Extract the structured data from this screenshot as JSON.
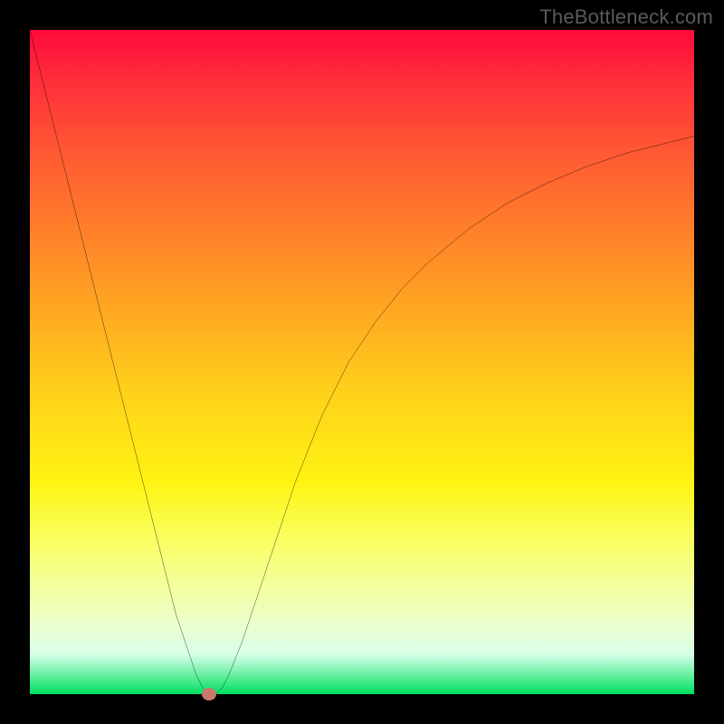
{
  "watermark": "TheBottleneck.com",
  "chart_data": {
    "type": "line",
    "title": "",
    "xlabel": "",
    "ylabel": "",
    "xlim": [
      0,
      100
    ],
    "ylim": [
      0,
      100
    ],
    "series": [
      {
        "name": "bottleneck-curve",
        "x": [
          0,
          2,
          4,
          6,
          8,
          10,
          12,
          14,
          16,
          18,
          20,
          22,
          24,
          25,
          26,
          27,
          28,
          29,
          30,
          32,
          34,
          36,
          38,
          40,
          44,
          48,
          52,
          56,
          60,
          66,
          72,
          78,
          84,
          90,
          96,
          100
        ],
        "y": [
          100,
          92,
          84,
          76,
          68,
          60,
          52,
          44,
          36,
          28,
          20,
          12,
          6,
          3,
          1,
          0,
          0,
          1,
          3,
          8,
          14,
          20,
          26,
          32,
          42,
          50,
          56,
          61,
          65,
          70,
          74,
          77,
          79.5,
          81.5,
          83,
          84
        ]
      }
    ],
    "marker": {
      "x": 27,
      "y": 0,
      "color": "#c77a6a"
    },
    "gradient_colors": {
      "top": "#ff0a3c",
      "mid_upper": "#ff7f2a",
      "mid": "#ffd21a",
      "mid_lower": "#f9ff5a",
      "bottom": "#00e060"
    }
  }
}
